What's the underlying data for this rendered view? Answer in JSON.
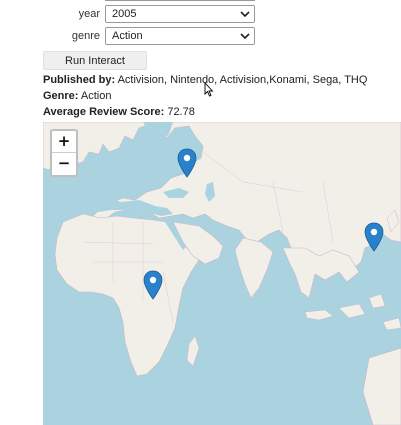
{
  "form": {
    "year_label": "year",
    "year_value": "2005",
    "genre_label": "genre",
    "genre_value": "Action",
    "run_button": "Run Interact"
  },
  "info": {
    "published_label": "Published by:",
    "published_value": " Activision, Nintendo, Activision,Konami, Sega, THQ",
    "genre_label": "Genre:",
    "genre_value": " Action",
    "score_label": "Average Review Score:",
    "score_value": " 72.78"
  },
  "map": {
    "zoom_in": "+",
    "zoom_out": "−",
    "marker_color": "#2a81cb",
    "water_color": "#aad3df",
    "land_color": "#f2efe9"
  }
}
